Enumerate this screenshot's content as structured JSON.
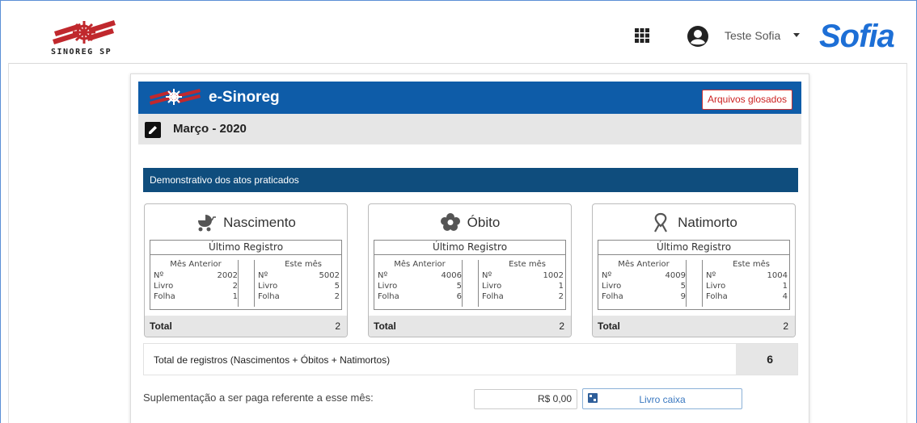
{
  "topbar": {
    "logo_text": "SINOREG SP",
    "user_name": "Teste Sofia",
    "brand": "Sofia",
    "icons": [
      "apps-grid-icon",
      "user-circle-icon",
      "caret-down-icon"
    ]
  },
  "card": {
    "header_title": "e-Sinoreg",
    "glosados_label": "Arquivos glosados",
    "period": "Março - 2020",
    "section_title": "Demonstrativo dos atos praticados"
  },
  "boxes": [
    {
      "title": "Nascimento",
      "icon": "baby-stroller-icon",
      "registro_label": "Último Registro",
      "anterior_label": "Mês Anterior",
      "atual_label": "Este mês",
      "anterior": {
        "n_label": "Nº",
        "n": "2002",
        "livro_label": "Livro",
        "livro": "2",
        "folha_label": "Folha",
        "folha": "1"
      },
      "atual": {
        "n_label": "Nº",
        "n": "5002",
        "livro_label": "Livro",
        "livro": "5",
        "folha_label": "Folha",
        "folha": "2"
      },
      "total_label": "Total",
      "total": "2"
    },
    {
      "title": "Óbito",
      "icon": "flower-icon",
      "registro_label": "Último Registro",
      "anterior_label": "Mês Anterior",
      "atual_label": "Este mês",
      "anterior": {
        "n_label": "Nº",
        "n": "4006",
        "livro_label": "Livro",
        "livro": "5",
        "folha_label": "Folha",
        "folha": "6"
      },
      "atual": {
        "n_label": "Nº",
        "n": "1002",
        "livro_label": "Livro",
        "livro": "1",
        "folha_label": "Folha",
        "folha": "2"
      },
      "total_label": "Total",
      "total": "2"
    },
    {
      "title": "Natimorto",
      "icon": "ribbon-icon",
      "registro_label": "Último Registro",
      "anterior_label": "Mês Anterior",
      "atual_label": "Este mês",
      "anterior": {
        "n_label": "Nº",
        "n": "4009",
        "livro_label": "Livro",
        "livro": "5",
        "folha_label": "Folha",
        "folha": "9"
      },
      "atual": {
        "n_label": "Nº",
        "n": "1004",
        "livro_label": "Livro",
        "livro": "1",
        "folha_label": "Folha",
        "folha": "4"
      },
      "total_label": "Total",
      "total": "2"
    }
  ],
  "summary": {
    "label": "Total de registros (Nascimentos + Óbitos + Natimortos)",
    "value": "6"
  },
  "suplementacao": {
    "label": "Suplementação a ser paga referente a esse mês:",
    "value": "R$ 0,00",
    "button_label": "Livro caixa"
  },
  "colors": {
    "header_blue": "#0e5ca8",
    "section_blue": "#0f4d7d",
    "brand_blue": "#1d6fd6",
    "glosados_red": "#c22"
  }
}
